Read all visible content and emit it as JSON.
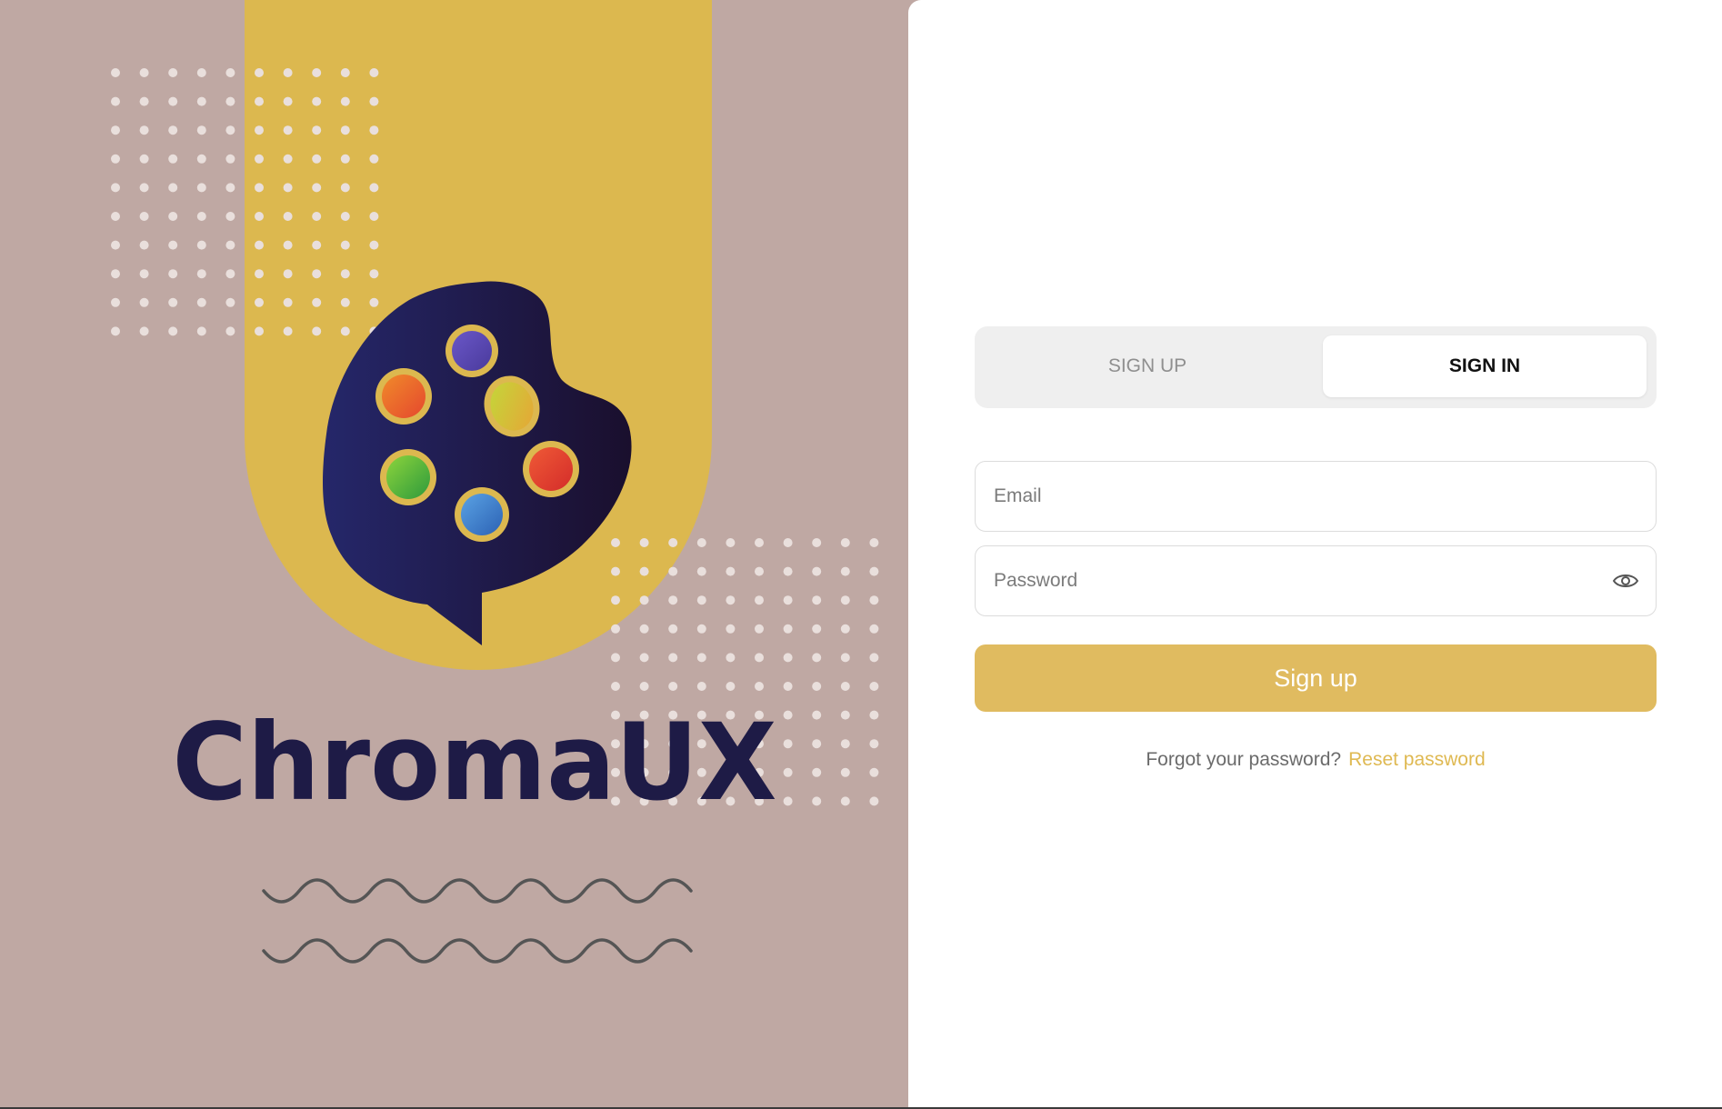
{
  "brand": {
    "name": "ChromaUX"
  },
  "colors": {
    "left_background": "#bfa8a3",
    "accent_yellow": "#dcb84f",
    "palette_navy": "#1e1b46",
    "button_yellow": "#e0bb60",
    "link_yellow": "#dfb952",
    "wave_gray": "#555555"
  },
  "auth_tabs": {
    "signup_label": "SIGN UP",
    "signin_label": "SIGN IN",
    "active": "SIGN IN"
  },
  "form": {
    "email_placeholder": "Email",
    "password_placeholder": "Password",
    "password_toggle_icon": "eye-icon",
    "submit_label": "Sign up",
    "forgot_text": "Forgot your password?",
    "reset_link": "Reset password"
  }
}
